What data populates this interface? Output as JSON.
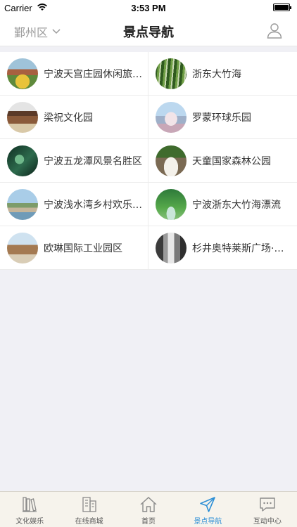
{
  "status": {
    "carrier": "Carrier",
    "time": "3:53 PM"
  },
  "nav": {
    "district": "鄞州区",
    "title": "景点导航"
  },
  "spots": [
    {
      "label": "宁波天宫庄园休闲旅游区",
      "thumb": "park-garden"
    },
    {
      "label": "浙东大竹海",
      "thumb": "bamboo-forest"
    },
    {
      "label": "梁祝文化园",
      "thumb": "pavilion"
    },
    {
      "label": "罗蒙环球乐园",
      "thumb": "castle"
    },
    {
      "label": "宁波五龙潭风景名胜区",
      "thumb": "waterfall-green"
    },
    {
      "label": "天童国家森林公园",
      "thumb": "waterfall"
    },
    {
      "label": "宁波浅水湾乡村欢乐世界",
      "thumb": "village-lake"
    },
    {
      "label": "宁波浙东大竹海漂流",
      "thumb": "river-forest"
    },
    {
      "label": "欧琳国际工业园区",
      "thumb": "industrial-park"
    },
    {
      "label": "杉井奥特莱斯广场·宁波",
      "thumb": "outlet-street"
    }
  ],
  "tabs": [
    {
      "label": "文化娱乐",
      "icon": "books-icon"
    },
    {
      "label": "在线商城",
      "icon": "building-icon"
    },
    {
      "label": "首页",
      "icon": "home-icon"
    },
    {
      "label": "景点导航",
      "icon": "navigation-arrow-icon",
      "active": true
    },
    {
      "label": "互动中心",
      "icon": "chat-bubble-icon"
    }
  ],
  "colors": {
    "active": "#2d8fd6",
    "inactive": "#8a8a8a",
    "tabbar_bg": "#f6f3ec"
  }
}
